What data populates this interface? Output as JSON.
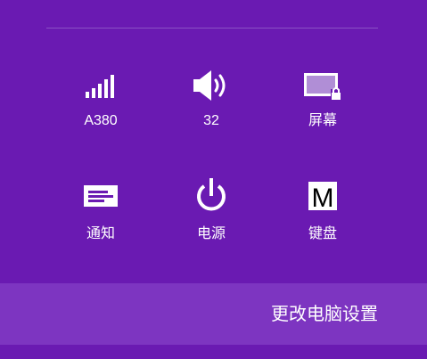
{
  "panel": {
    "quick_settings": [
      {
        "id": "network",
        "label": "A380",
        "icon": "signal-bars-icon"
      },
      {
        "id": "volume",
        "label": "32",
        "icon": "speaker-icon"
      },
      {
        "id": "screen",
        "label": "屏幕",
        "icon": "screen-lock-icon"
      },
      {
        "id": "notifications",
        "label": "通知",
        "icon": "notification-icon"
      },
      {
        "id": "power",
        "label": "电源",
        "icon": "power-icon"
      },
      {
        "id": "keyboard",
        "label": "键盘",
        "icon": "keyboard-m-icon",
        "glyph": "M"
      }
    ],
    "change_pc_settings": "更改电脑设置"
  },
  "colors": {
    "background": "#6a1ab2",
    "bottom_bar": "#7d35c1",
    "foreground": "#ffffff",
    "screen_fill": "#b08ed6"
  }
}
